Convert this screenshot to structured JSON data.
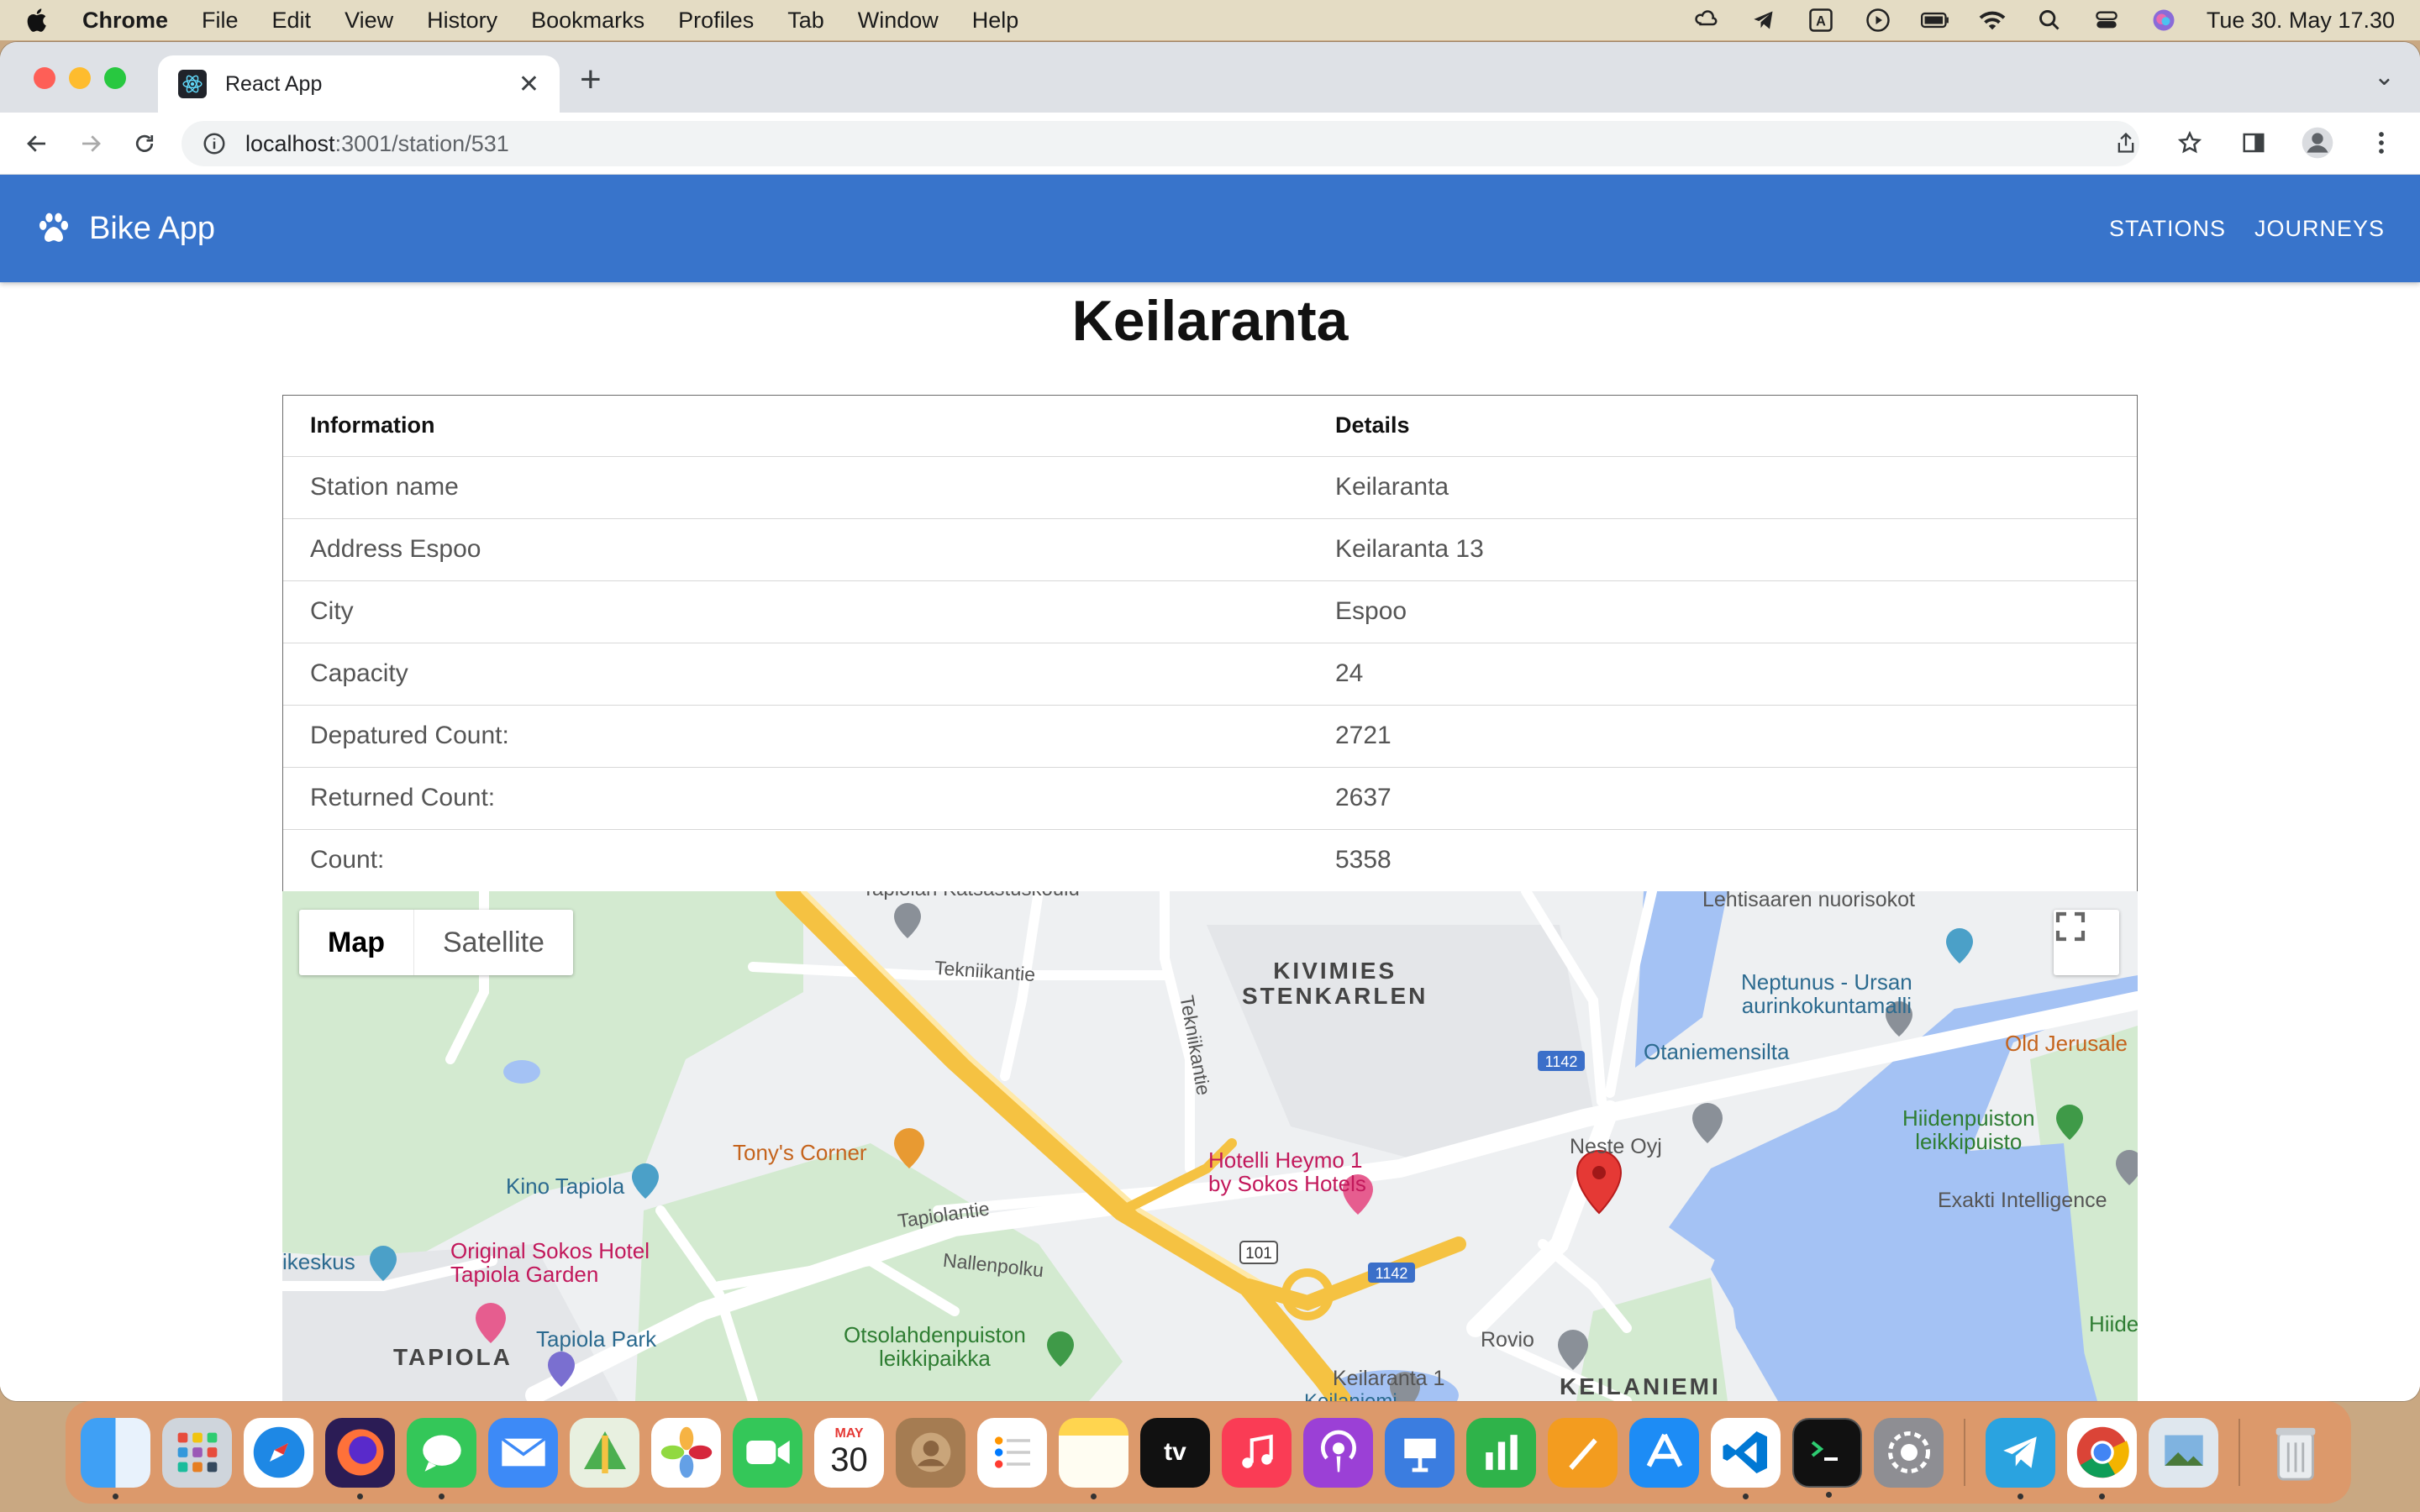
{
  "menubar": {
    "app": "Chrome",
    "items": [
      "File",
      "Edit",
      "View",
      "History",
      "Bookmarks",
      "Profiles",
      "Tab",
      "Window",
      "Help"
    ],
    "clock": "Tue 30. May  17.30"
  },
  "browser": {
    "tab_title": "React App",
    "url_host": "localhost",
    "url_path": ":3001/station/531"
  },
  "app": {
    "brand": "Bike App",
    "nav": {
      "stations": "STATIONS",
      "journeys": "JOURNEYS"
    }
  },
  "station": {
    "title": "Keilaranta",
    "headers": {
      "info": "Information",
      "details": "Details"
    },
    "rows": [
      {
        "label": "Station name",
        "value": "Keilaranta"
      },
      {
        "label": "Address Espoo",
        "value": "Keilaranta 13"
      },
      {
        "label": "City",
        "value": "Espoo"
      },
      {
        "label": "Capacity",
        "value": "24"
      },
      {
        "label": "Depatured Count:",
        "value": "2721"
      },
      {
        "label": "Returned Count:",
        "value": "2637"
      },
      {
        "label": "Count:",
        "value": "5358"
      }
    ]
  },
  "map": {
    "type_map": "Map",
    "type_satellite": "Satellite",
    "labels": {
      "kivimies": "KIVIMIES\nSTENKARLEN",
      "tapiola": "TAPIOLA",
      "keilaniemi": "KEILANIEMI",
      "tekniikantie1": "Tekniikantie",
      "tekniikantie2": "Tekniikantie",
      "tapiolantie": "Tapiolantie",
      "nallenpolku": "Nallenpolku",
      "tonys": "Tony's Corner",
      "kino": "Kino Tapiola",
      "hotelli": "Hotelli Heymo 1\nby Sokos Hotels",
      "sokos": "Original Sokos Hotel\nTapiola Garden",
      "tapiolapark": "Tapiola Park",
      "otsolahden": "Otsolahdenpuiston\nleikkipaikka",
      "neste": "Neste Oyj",
      "rovio": "Rovio",
      "keilaranta1": "Keilaranta 1",
      "keilaniemi_m": "Keilaniemi",
      "neptunus": "Neptunus - Ursan\naurinkokuntamalli",
      "otaniemensilta": "Otaniemensilta",
      "hiidenpuiston": "Hiidenpuiston\nleikkipuisto",
      "exakti": "Exakti Intelligence",
      "oldjerusalem": "Old Jerusale",
      "lehtisaaren": "Lehtisaaren nuorisokot",
      "ikeskus": "ikeskus",
      "hiide": "Hiide",
      "route101": "101",
      "route1142a": "1142",
      "route1142b": "1142",
      "katsastus": "Tapiolan Katsastuskoulu"
    },
    "colors": {
      "water": "#a4c2f4",
      "park": "#cde8c9",
      "highway": "#f5c242",
      "marker": "#e53935"
    }
  },
  "dock": {
    "calendar_month": "MAY",
    "calendar_day": "30",
    "tv": "tv"
  }
}
